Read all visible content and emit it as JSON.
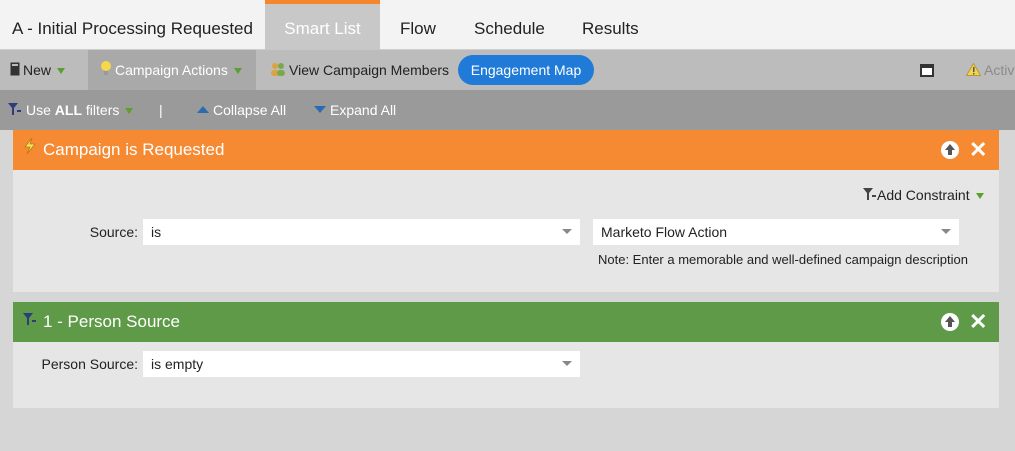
{
  "tabs": {
    "title": "A - Initial Processing Requested",
    "items": [
      "Smart List",
      "Flow",
      "Schedule",
      "Results"
    ]
  },
  "toolbar": {
    "new_label": "New",
    "campaign_actions_label": "Campaign Actions",
    "view_members_label": "View Campaign Members",
    "engagement_map_label": "Engagement Map",
    "active_label": "Active"
  },
  "filterbar": {
    "use_prefix": "Use",
    "use_bold": "ALL",
    "use_suffix": "filters",
    "separator": "|",
    "collapse_label": "Collapse All",
    "expand_label": "Expand All"
  },
  "trigger": {
    "title": "Campaign is Requested",
    "add_constraint_label": "Add Constraint",
    "source_label": "Source:",
    "operator_value": "is",
    "value": "Marketo Flow Action",
    "note": "Note: Enter a memorable and well-defined campaign description"
  },
  "filter1": {
    "title": "1 - Person Source",
    "field_label": "Person Source:",
    "operator_value": "is empty"
  },
  "colors": {
    "trigger_header": "#f58a33",
    "filter_header": "#5e9a48",
    "accent_blue": "#1f7ad8"
  }
}
